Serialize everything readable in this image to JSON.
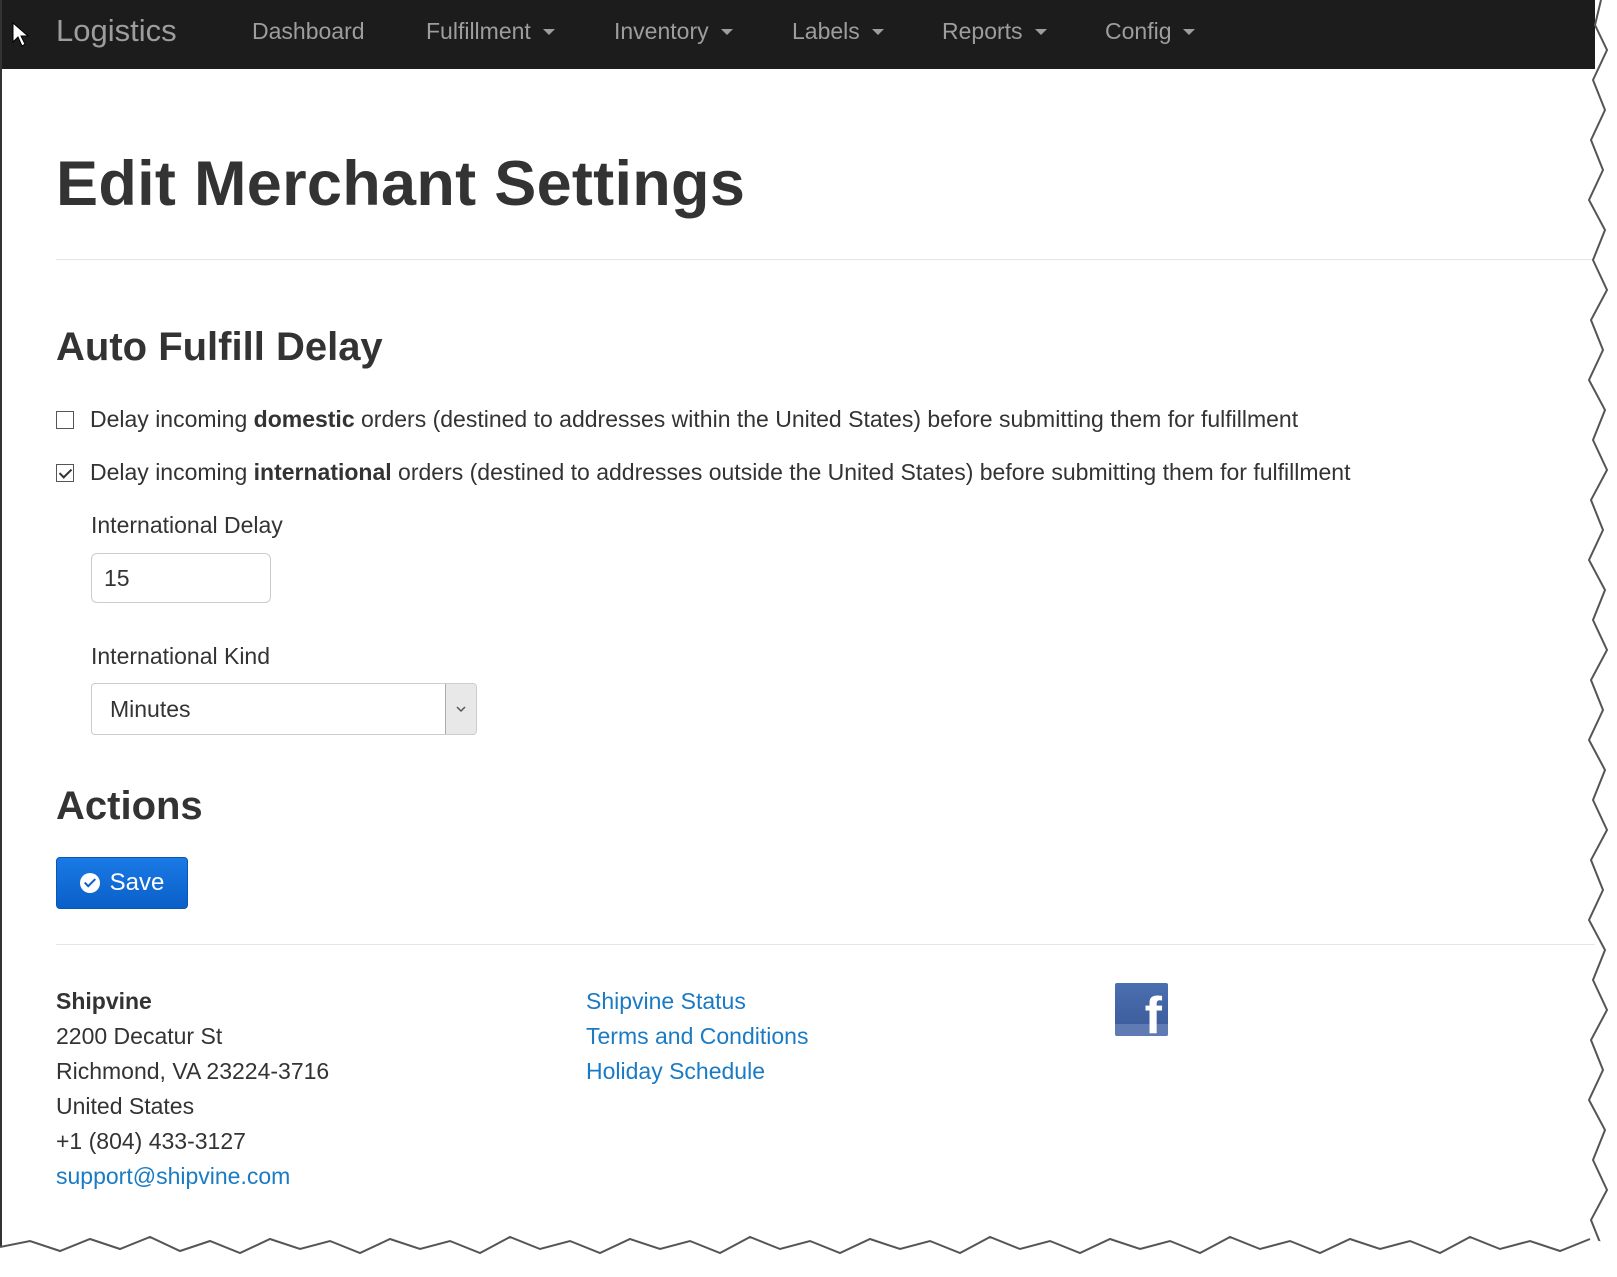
{
  "navbar": {
    "brand": "Logistics",
    "items": [
      {
        "label": "Dashboard"
      },
      {
        "label": "Fulfillment"
      },
      {
        "label": "Inventory"
      },
      {
        "label": "Labels"
      },
      {
        "label": "Reports"
      },
      {
        "label": "Config"
      }
    ]
  },
  "page": {
    "title": "Edit Merchant Settings"
  },
  "auto_fulfill": {
    "heading": "Auto Fulfill Delay",
    "domestic": {
      "checked": false,
      "prefix": "Delay incoming ",
      "bold": "domestic",
      "suffix": " orders (destined to addresses within the United States) before submitting them for fulfillment"
    },
    "international": {
      "checked": true,
      "prefix": "Delay incoming ",
      "bold": "international",
      "suffix": " orders (destined to addresses outside the United States) before submitting them for fulfillment"
    },
    "delay_label": "International Delay",
    "delay_value": "15",
    "kind_label": "International Kind",
    "kind_value": "Minutes"
  },
  "actions": {
    "heading": "Actions",
    "save_label": "Save"
  },
  "footer": {
    "company": "Shipvine",
    "address1": "2200 Decatur St",
    "address2": "Richmond, VA 23224-3716",
    "country": "United States",
    "phone": "+1 (804) 433-3127",
    "email": "support@shipvine.com",
    "links": [
      {
        "label": "Shipvine Status"
      },
      {
        "label": "Terms and Conditions"
      },
      {
        "label": "Holiday Schedule"
      }
    ],
    "social_icon": "facebook-icon"
  },
  "colors": {
    "navbar_bg": "#1c1c1c",
    "link": "#1a7bc4",
    "primary_button": "#0a5fc8"
  }
}
